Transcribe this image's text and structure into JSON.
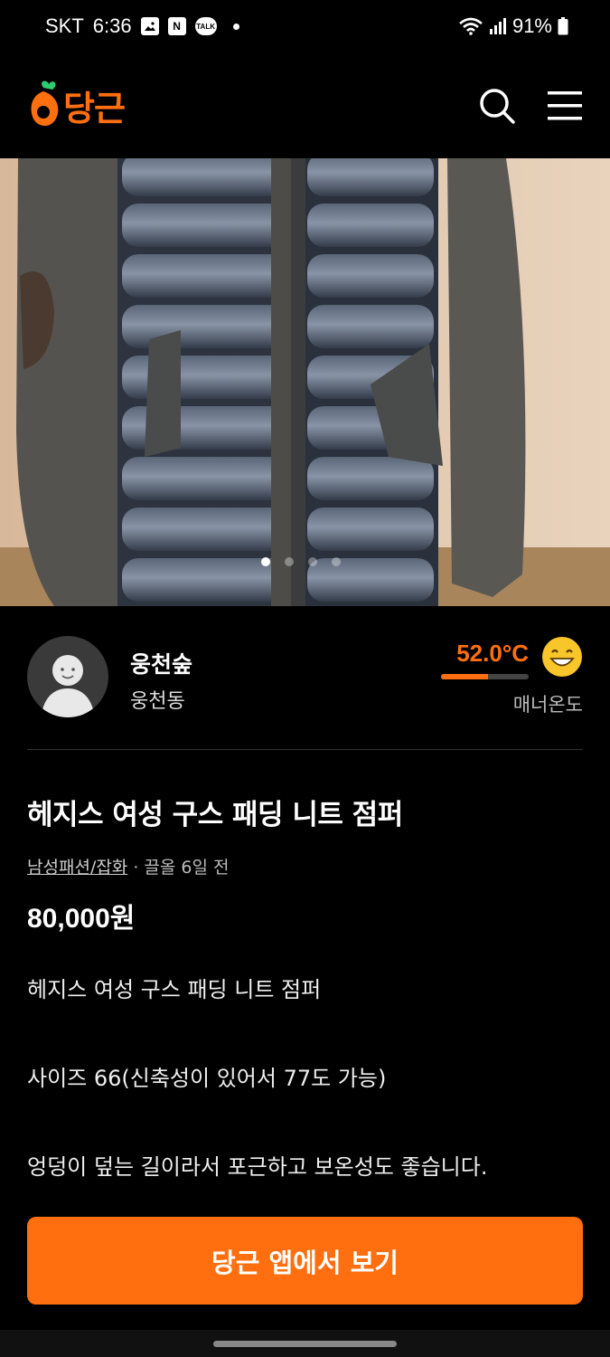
{
  "status_bar": {
    "carrier": "SKT",
    "time": "6:36",
    "notif_icons": [
      "gallery-icon",
      "naver-icon",
      "talk-icon"
    ],
    "naver_glyph": "N",
    "talk_glyph": "TALK",
    "battery": "91%"
  },
  "app_bar": {
    "logo_text": "당근",
    "brand_color": "#ff6f0f"
  },
  "hero": {
    "image_description_icon": "product-photo",
    "carousel_count": 4,
    "carousel_active": 0
  },
  "seller": {
    "name": "웅천숲",
    "location": "웅천동",
    "temperature": "52.0°C",
    "temperature_level": 0.54,
    "manner_label": "매너온도"
  },
  "listing": {
    "title": "헤지스 여성 구스 패딩 니트 점퍼",
    "category": "남성패션/잡화",
    "separator": " · ",
    "time_ago": "끌올 6일 전",
    "price": "80,000원",
    "description": [
      "헤지스 여성 구스 패딩 니트 점퍼",
      "사이즈 66(신축성이 있어서 77도 가능)",
      "엉덩이 덮는 길이라서 포근하고 보온성도 좋습니다."
    ]
  },
  "cta": {
    "label": "당근 앱에서 보기"
  }
}
